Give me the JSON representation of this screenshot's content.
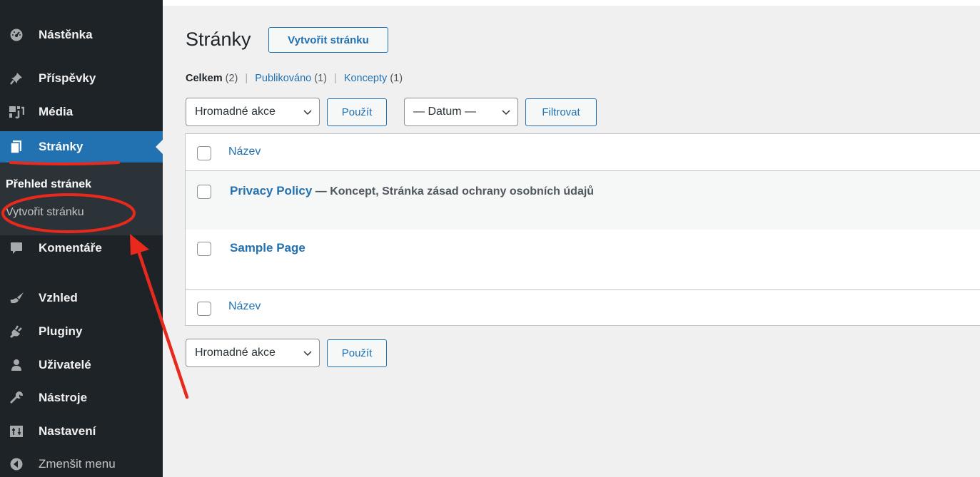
{
  "sidebar": {
    "items": [
      {
        "label": "Nástěnka",
        "icon": "dashboard-icon"
      },
      {
        "label": "Příspěvky",
        "icon": "pin-icon"
      },
      {
        "label": "Média",
        "icon": "media-icon"
      },
      {
        "label": "Stránky",
        "icon": "pages-icon"
      },
      {
        "label": "Komentáře",
        "icon": "comment-icon"
      },
      {
        "label": "Vzhled",
        "icon": "brush-icon"
      },
      {
        "label": "Pluginy",
        "icon": "plugin-icon"
      },
      {
        "label": "Uživatelé",
        "icon": "user-icon"
      },
      {
        "label": "Nástroje",
        "icon": "wrench-icon"
      },
      {
        "label": "Nastavení",
        "icon": "settings-icon"
      },
      {
        "label": "Zmenšit menu",
        "icon": "collapse-icon"
      }
    ],
    "submenu": {
      "overview": "Přehled stránek",
      "create": "Vytvořit stránku"
    }
  },
  "main": {
    "title": "Stránky",
    "add_new": "Vytvořit stránku",
    "filters": {
      "all": {
        "label": "Celkem",
        "count": "(2)"
      },
      "published": {
        "label": "Publikováno",
        "count": "(1)"
      },
      "drafts": {
        "label": "Koncepty",
        "count": "(1)"
      },
      "separator": "|"
    },
    "bulk_action": "Hromadné akce",
    "apply": "Použít",
    "date_filter": "— Datum —",
    "filter_button": "Filtrovat",
    "table": {
      "column_title": "Název",
      "rows": [
        {
          "title": "Privacy Policy",
          "state": " — Koncept, Stránka zásad ochrany osobních údajů"
        },
        {
          "title": "Sample Page",
          "state": ""
        }
      ]
    }
  },
  "colors": {
    "sidebar_bg": "#1d2327",
    "accent": "#2271b1",
    "annotation": "#e8291c"
  }
}
